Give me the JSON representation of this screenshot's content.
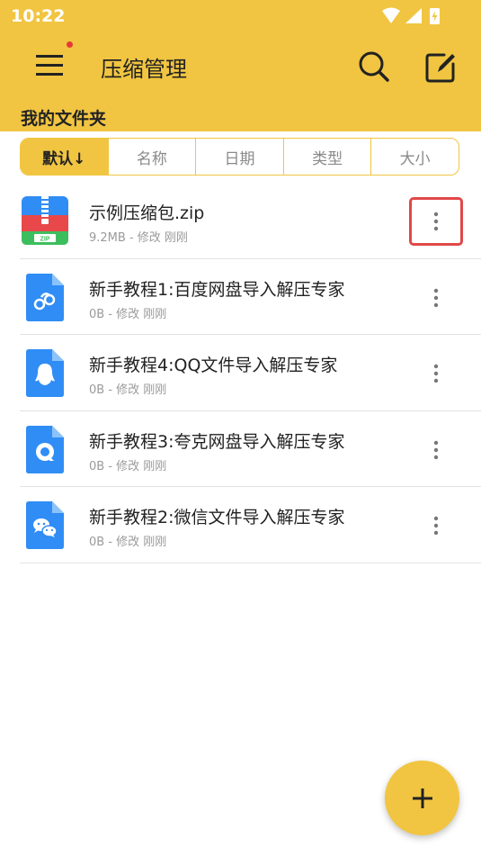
{
  "status_bar": {
    "time": "10:22"
  },
  "toolbar": {
    "title": "压缩管理"
  },
  "section": {
    "title": "我的文件夹"
  },
  "sort_tabs": [
    {
      "label": "默认↓",
      "active": true
    },
    {
      "label": "名称",
      "active": false
    },
    {
      "label": "日期",
      "active": false
    },
    {
      "label": "类型",
      "active": false
    },
    {
      "label": "大小",
      "active": false
    }
  ],
  "files": [
    {
      "name": "示例压缩包.zip",
      "meta": "9.2MB - 修改 刚刚",
      "icon": "zip-icon"
    },
    {
      "name": "新手教程1:百度网盘导入解压专家",
      "meta": "0B - 修改 刚刚",
      "icon": "baidu-netdisk-file-icon"
    },
    {
      "name": "新手教程4:QQ文件导入解压专家",
      "meta": "0B - 修改 刚刚",
      "icon": "qq-file-icon"
    },
    {
      "name": "新手教程3:夸克网盘导入解压专家",
      "meta": "0B - 修改 刚刚",
      "icon": "quark-file-icon"
    },
    {
      "name": "新手教程2:微信文件导入解压专家",
      "meta": "0B - 修改 刚刚",
      "icon": "wechat-file-icon"
    }
  ],
  "colors": {
    "accent": "#F1C541",
    "highlight": "#E04848",
    "file_blue": "#2F8DF5"
  }
}
